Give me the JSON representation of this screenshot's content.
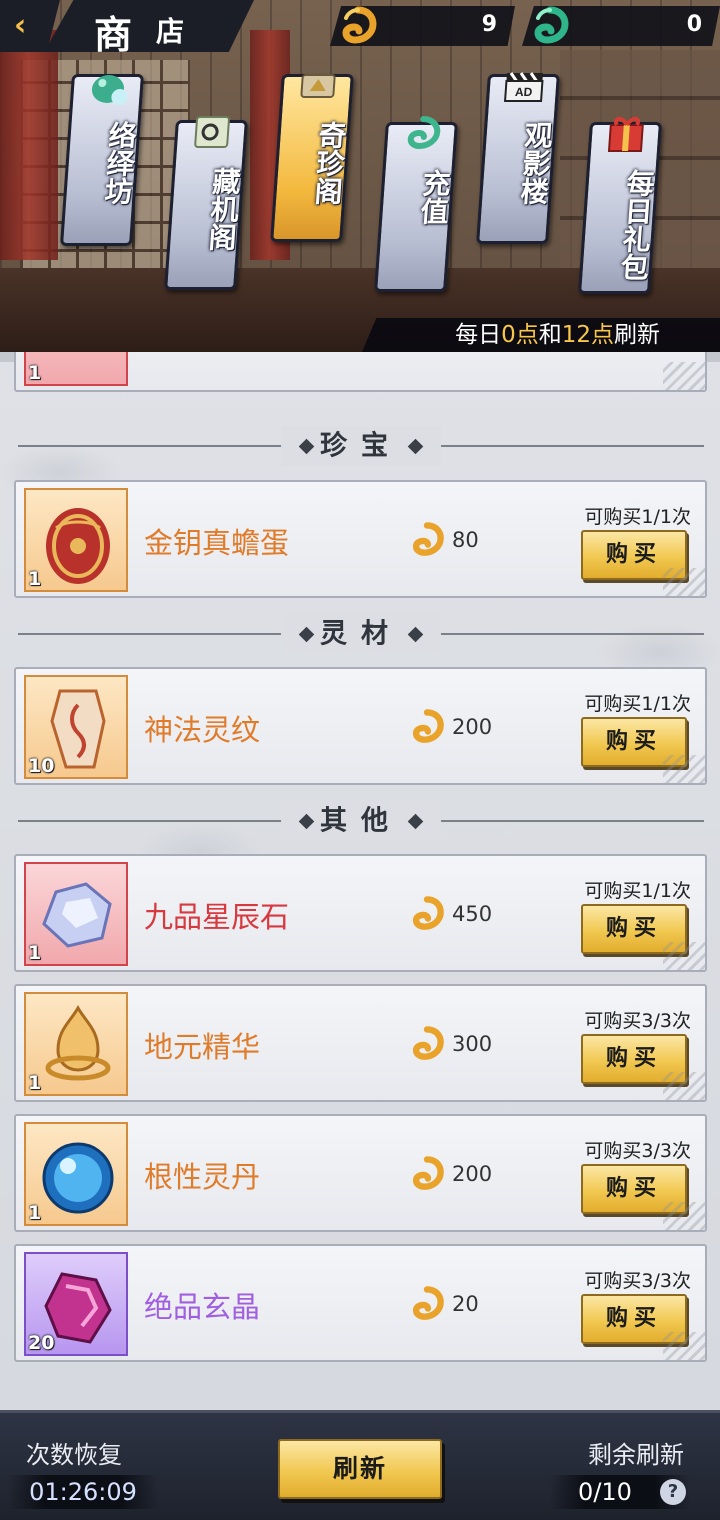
{
  "header": {
    "title_big": "商",
    "title_small": "店",
    "currency": [
      {
        "icon": "gold-ruyi-coin-icon",
        "value": "9"
      },
      {
        "icon": "jade-ruyi-coin-icon",
        "value": "0"
      }
    ],
    "tabs": [
      {
        "label": "络绎坊",
        "icon": "jade-dragon-icon",
        "active": false
      },
      {
        "label": "藏机阁",
        "icon": "scroll-icon",
        "active": false
      },
      {
        "label": "奇珍阁",
        "icon": "treasure-scroll-icon",
        "active": true
      },
      {
        "label": "充值",
        "icon": "jade-coin-icon",
        "active": false
      },
      {
        "label": "观影楼",
        "icon": "ad-clapper-icon",
        "active": false
      },
      {
        "label": "每日礼包",
        "icon": "gift-box-icon",
        "active": false
      }
    ],
    "refresh_note": {
      "prefix": "每日",
      "h1": "0点",
      "mid": "和",
      "h2": "12点",
      "suffix": "刷新"
    }
  },
  "partial_item": {
    "qty": "1"
  },
  "sections": [
    {
      "title": "珍宝"
    },
    {
      "title": "灵材"
    },
    {
      "title": "其他"
    }
  ],
  "items": [
    {
      "name": "金钥真蟾蛋",
      "name_color": "#e07b2a",
      "qty": "1",
      "price": "80",
      "limit": "可购买1/1次",
      "buy": "购买",
      "icon": "golden-egg-icon",
      "rarity": "orange"
    },
    {
      "name": "神法灵纹",
      "name_color": "#e07b2a",
      "qty": "10",
      "price": "200",
      "limit": "可购买1/1次",
      "buy": "购买",
      "icon": "rune-talisman-icon",
      "rarity": "orange"
    },
    {
      "name": "九品星辰石",
      "name_color": "#d8393f",
      "qty": "1",
      "price": "450",
      "limit": "可购买1/1次",
      "buy": "购买",
      "icon": "crystal-gem-icon",
      "rarity": "red"
    },
    {
      "name": "地元精华",
      "name_color": "#e07b2a",
      "qty": "1",
      "price": "300",
      "limit": "可购买3/3次",
      "buy": "购买",
      "icon": "earth-essence-icon",
      "rarity": "orange"
    },
    {
      "name": "根性灵丹",
      "name_color": "#e07b2a",
      "qty": "1",
      "price": "200",
      "limit": "可购买3/3次",
      "buy": "购买",
      "icon": "blue-orb-icon",
      "rarity": "orange"
    },
    {
      "name": "绝品玄晶",
      "name_color": "#a05ee0",
      "qty": "20",
      "price": "20",
      "limit": "可购买3/3次",
      "buy": "购买",
      "icon": "purple-crystal-icon",
      "rarity": "purple"
    }
  ],
  "footer": {
    "recover_label": "次数恢复",
    "recover_timer": "01:26:09",
    "refresh_button": "刷新",
    "remaining_label": "剩余刷新",
    "remaining_value": "0/10",
    "help": "?"
  },
  "colors": {
    "accent_gold": "#f1c850",
    "highlight": "#f7c64a"
  }
}
